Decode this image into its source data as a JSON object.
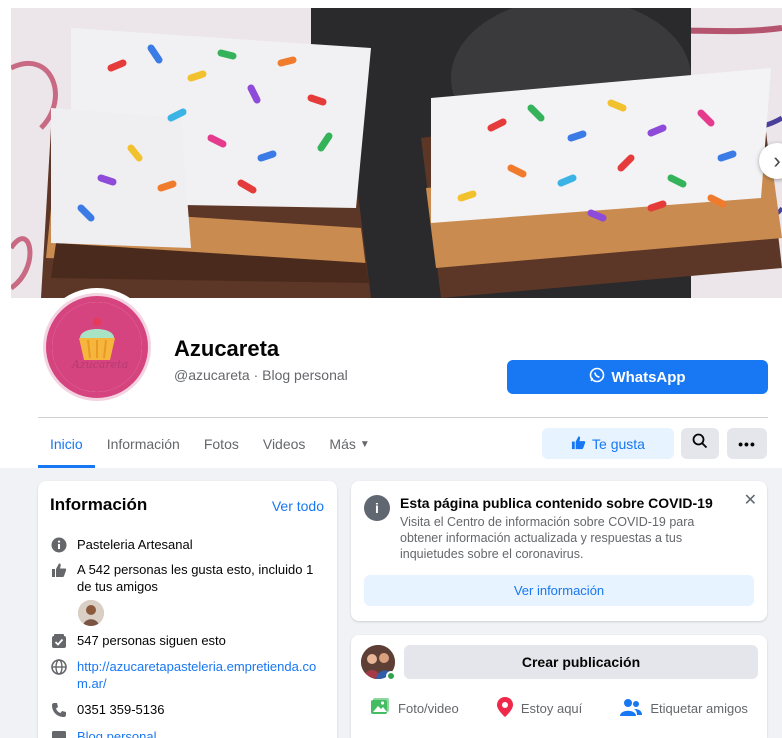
{
  "cover": {
    "next_icon": "chevron-right-icon",
    "next_glyph": "›"
  },
  "profile": {
    "name": "Azucareta",
    "subtitle": "@azucareta · Blog personal",
    "logo_text": "Azucareta"
  },
  "whatsapp": {
    "label": "WhatsApp",
    "icon": "whatsapp-icon"
  },
  "tabs": [
    {
      "label": "Inicio",
      "active": true
    },
    {
      "label": "Información",
      "active": false
    },
    {
      "label": "Fotos",
      "active": false
    },
    {
      "label": "Videos",
      "active": false
    },
    {
      "label": "Más",
      "active": false
    }
  ],
  "actions": {
    "like_label": "Te gusta",
    "more_label": "•••"
  },
  "info": {
    "title": "Información",
    "see_all": "Ver todo",
    "category": "Pasteleria Artesanal",
    "likes": "A 542 personas les gusta esto, incluido 1 de tus amigos",
    "followers": "547 personas siguen esto",
    "website": "http://azucaretapasteleria.empretienda.com.ar/",
    "phone": "0351 359-5136",
    "type": "Blog personal"
  },
  "covid": {
    "icon_glyph": "i",
    "title": "Esta página publica contenido sobre COVID-19",
    "text": "Visita el Centro de información sobre COVID-19 para obtener información actualizada y respuestas a tus inquietudes sobre el coronavirus.",
    "close_glyph": "✕",
    "button": "Ver información"
  },
  "create_post": {
    "button": "Crear publicación",
    "actions": [
      {
        "label": "Foto/video",
        "icon": "photo-icon"
      },
      {
        "label": "Estoy aquí",
        "icon": "location-pin-icon"
      },
      {
        "label": "Etiquetar amigos",
        "icon": "tag-friends-icon"
      }
    ]
  },
  "colors": {
    "primary": "#1877f2",
    "light_primary": "#e7f3ff",
    "gray_button": "#e4e6eb",
    "secondary_text": "#65676b",
    "photo_green": "#45bd62",
    "pin_red": "#f02849"
  }
}
